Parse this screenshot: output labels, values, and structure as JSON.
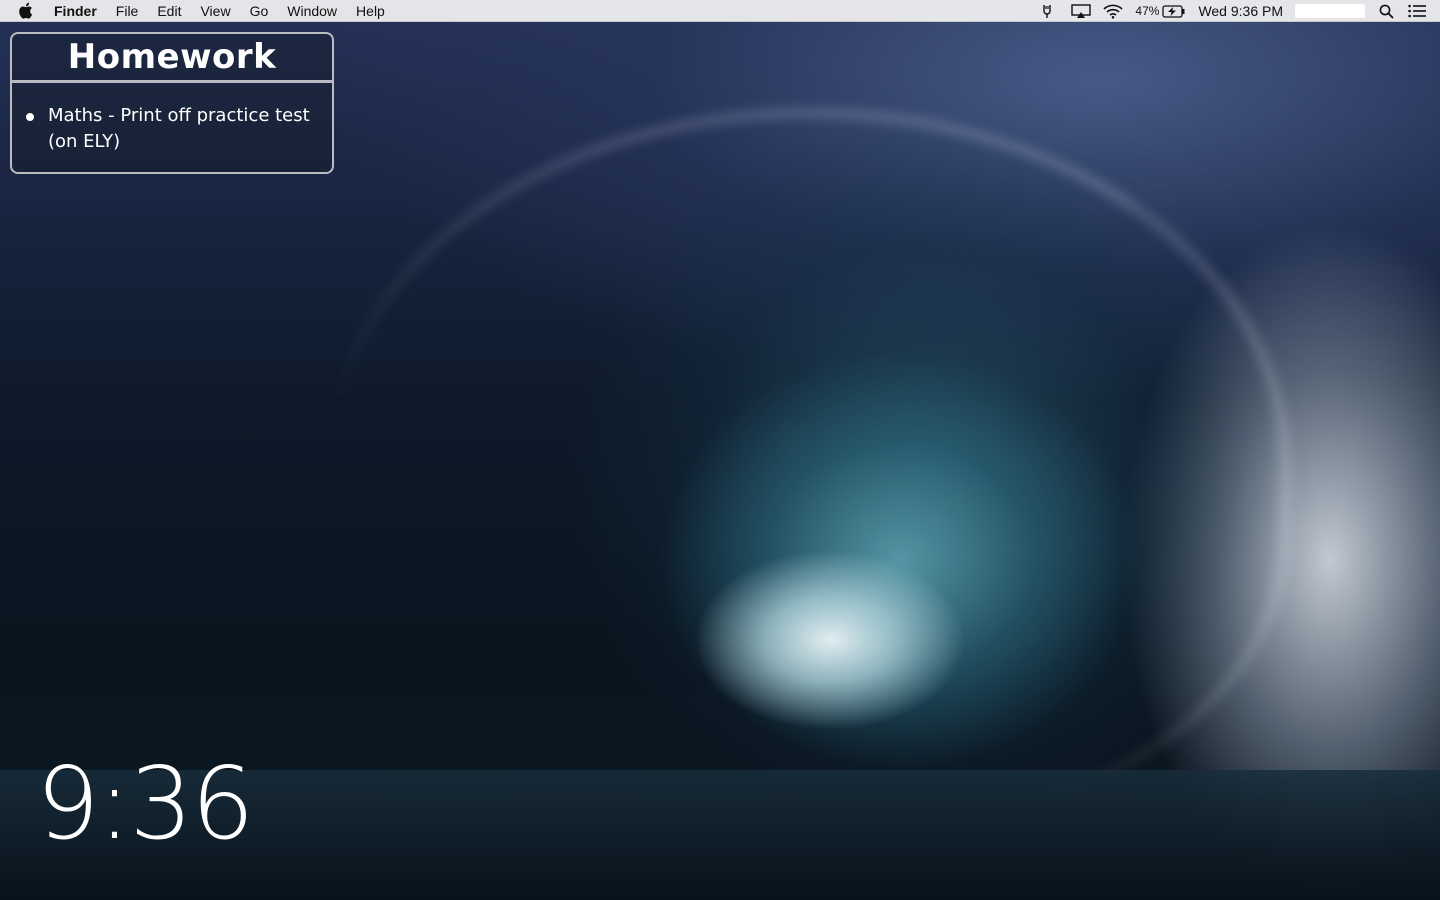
{
  "menubar": {
    "apple_icon": "apple-logo-icon",
    "app_name": "Finder",
    "menus": [
      "File",
      "Edit",
      "View",
      "Go",
      "Window",
      "Help"
    ],
    "status": {
      "battery_percent": "47%",
      "clock": "Wed 9:36 PM",
      "icons": [
        "usb-icon",
        "airplay-icon",
        "wifi-icon",
        "battery-charging-icon",
        "spotlight-search-icon",
        "notification-center-icon"
      ]
    }
  },
  "widget": {
    "title": "Homework",
    "items": [
      "Maths - Print off practice test (on ELY)"
    ]
  },
  "desktop_clock": {
    "time": "9:36"
  }
}
